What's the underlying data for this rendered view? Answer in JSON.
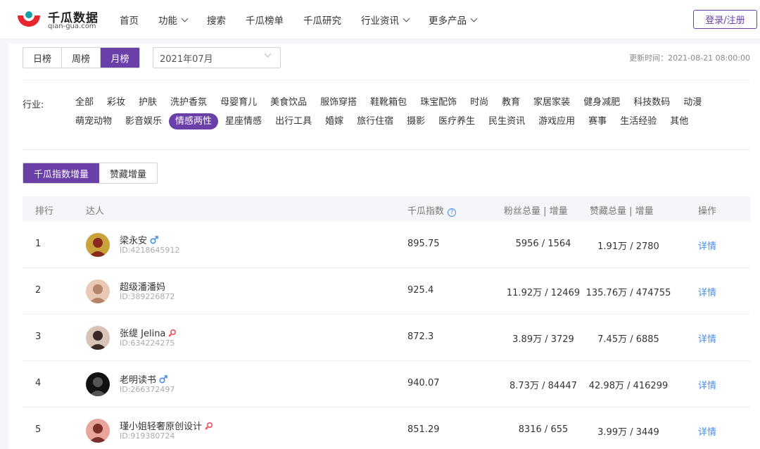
{
  "header": {
    "logo_name": "千瓜数据",
    "logo_domain": "qian-gua.com",
    "nav": [
      {
        "label": "首页",
        "dropdown": false
      },
      {
        "label": "功能",
        "dropdown": true
      },
      {
        "label": "搜索",
        "dropdown": false
      },
      {
        "label": "千瓜榜单",
        "dropdown": false
      },
      {
        "label": "千瓜研究",
        "dropdown": false
      },
      {
        "label": "行业资讯",
        "dropdown": true
      },
      {
        "label": "更多产品",
        "dropdown": true
      }
    ],
    "login_label": "登录/注册"
  },
  "filters": {
    "periods": [
      {
        "label": "日榜",
        "active": false
      },
      {
        "label": "周榜",
        "active": false
      },
      {
        "label": "月榜",
        "active": true
      }
    ],
    "date_value": "2021年07月",
    "update_time": "更新时间：2021-08-21 08:00:00"
  },
  "industry": {
    "label": "行业:",
    "tags": [
      {
        "label": "全部",
        "active": false
      },
      {
        "label": "彩妆",
        "active": false
      },
      {
        "label": "护肤",
        "active": false
      },
      {
        "label": "洗护香氛",
        "active": false
      },
      {
        "label": "母婴育儿",
        "active": false
      },
      {
        "label": "美食饮品",
        "active": false
      },
      {
        "label": "服饰穿搭",
        "active": false
      },
      {
        "label": "鞋靴箱包",
        "active": false
      },
      {
        "label": "珠宝配饰",
        "active": false
      },
      {
        "label": "时尚",
        "active": false
      },
      {
        "label": "教育",
        "active": false
      },
      {
        "label": "家居家装",
        "active": false
      },
      {
        "label": "健身减肥",
        "active": false
      },
      {
        "label": "科技数码",
        "active": false
      },
      {
        "label": "动漫",
        "active": false
      },
      {
        "label": "萌宠动物",
        "active": false
      },
      {
        "label": "影音娱乐",
        "active": false
      },
      {
        "label": "情感两性",
        "active": true
      },
      {
        "label": "星座情感",
        "active": false
      },
      {
        "label": "出行工具",
        "active": false
      },
      {
        "label": "婚嫁",
        "active": false
      },
      {
        "label": "旅行住宿",
        "active": false
      },
      {
        "label": "摄影",
        "active": false
      },
      {
        "label": "医疗养生",
        "active": false
      },
      {
        "label": "民生资讯",
        "active": false
      },
      {
        "label": "游戏应用",
        "active": false
      },
      {
        "label": "赛事",
        "active": false
      },
      {
        "label": "生活经验",
        "active": false
      },
      {
        "label": "其他",
        "active": false
      }
    ]
  },
  "metric_tabs": [
    {
      "label": "千瓜指数增量",
      "active": true
    },
    {
      "label": "赞藏增量",
      "active": false
    }
  ],
  "table": {
    "headers": {
      "rank": "排行",
      "influencer": "达人",
      "index": "千瓜指数",
      "fans": "粉丝总量 | 增量",
      "likes": "赞藏总量 | 增量",
      "action": "操作"
    },
    "rows": [
      {
        "rank": "1",
        "name": "梁永安",
        "gender": "male",
        "id": "ID:4218645912",
        "index": "895.75",
        "fans": "5956 / 1564",
        "likes": "1.91万 / 2780",
        "action": "详情",
        "avatar_bg": "#c9a23a",
        "avatar_fg": "#8a2a1c"
      },
      {
        "rank": "2",
        "name": "超级潘潘妈",
        "gender": "",
        "id": "ID:389226872",
        "index": "925.4",
        "fans": "11.92万 / 12469",
        "likes": "135.76万 / 474755",
        "action": "详情",
        "avatar_bg": "#e8c9b4",
        "avatar_fg": "#b5836a"
      },
      {
        "rank": "3",
        "name": "张缇 Jelina",
        "gender": "female",
        "id": "ID:634224275",
        "index": "872.3",
        "fans": "3.89万 / 3729",
        "likes": "7.45万 / 6885",
        "action": "详情",
        "avatar_bg": "#d9c2b8",
        "avatar_fg": "#3b2a26"
      },
      {
        "rank": "4",
        "name": "老明读书",
        "gender": "male",
        "id": "ID:266372497",
        "index": "940.07",
        "fans": "8.73万 / 84447",
        "likes": "42.98万 / 416299",
        "action": "详情",
        "avatar_bg": "#111111",
        "avatar_fg": "#555555"
      },
      {
        "rank": "5",
        "name": "瑾小姐轻奢原创设计",
        "gender": "female",
        "id": "ID:919380724",
        "index": "851.29",
        "fans": "8316 / 655",
        "likes": "3.99万 / 3449",
        "action": "详情",
        "avatar_bg": "#e9a59b",
        "avatar_fg": "#7a2f2a"
      }
    ]
  },
  "colors": {
    "accent": "#6a3fa8",
    "link": "#4a8ee8",
    "male": "#4a8ee8",
    "female": "#e8505b",
    "logo_red": "#e6252d"
  }
}
